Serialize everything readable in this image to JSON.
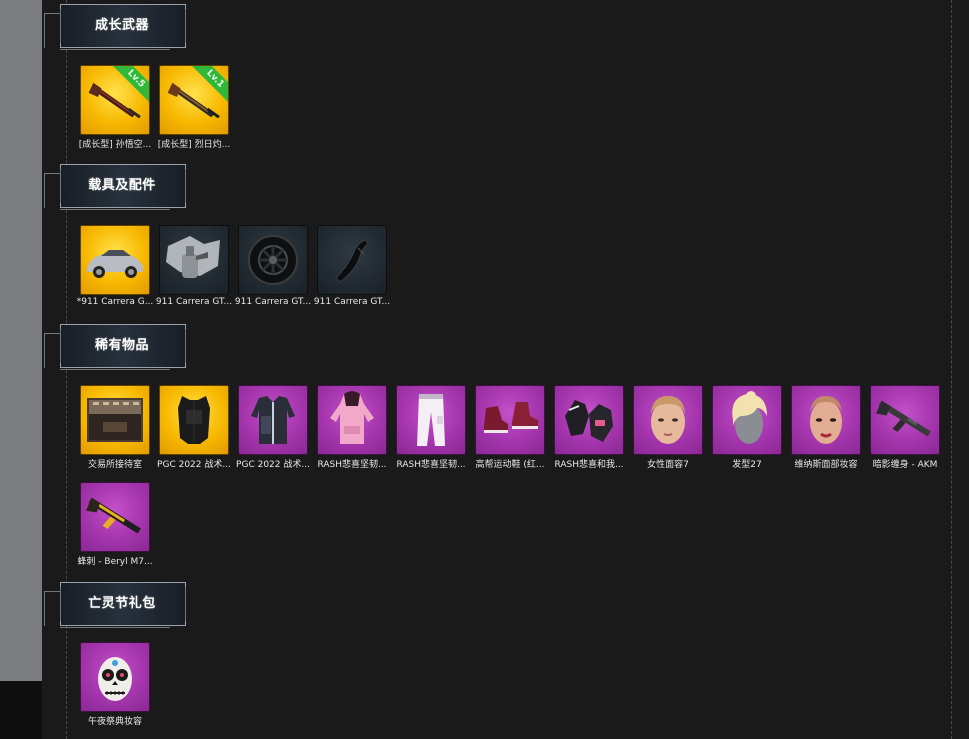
{
  "sections": [
    {
      "title": "成长武器",
      "items": [
        {
          "caption": "[成长型] 孙悟空...",
          "rarity": "gold",
          "icon": "shotgun-icon",
          "badge": "Lv.5"
        },
        {
          "caption": "[成长型] 烈日灼...",
          "rarity": "gold",
          "icon": "shotgun-icon",
          "badge": "Lv.1"
        }
      ]
    },
    {
      "title": "载具及配件",
      "items": [
        {
          "caption": "*911 Carrera G...",
          "rarity": "gold",
          "icon": "sports-car-icon"
        },
        {
          "caption": "911 Carrera GT...",
          "rarity": "dark",
          "icon": "car-paint-icon"
        },
        {
          "caption": "911 Carrera GT...",
          "rarity": "dark",
          "icon": "wheel-icon"
        },
        {
          "caption": "911 Carrera GT...",
          "rarity": "dark",
          "icon": "car-part-icon"
        }
      ]
    },
    {
      "title": "稀有物品",
      "items": [
        {
          "caption": "交易所接待室",
          "rarity": "gold",
          "icon": "room-icon"
        },
        {
          "caption": "PGC 2022 战术...",
          "rarity": "gold",
          "icon": "tactical-vest-icon"
        },
        {
          "caption": "PGC 2022 战术...",
          "rarity": "purple",
          "icon": "jacket-icon"
        },
        {
          "caption": "RASH悲喜坚韧...",
          "rarity": "purple",
          "icon": "hoodie-icon"
        },
        {
          "caption": "RASH悲喜坚韧...",
          "rarity": "purple",
          "icon": "pants-icon"
        },
        {
          "caption": "高帮运动鞋 (红...",
          "rarity": "purple",
          "icon": "sneakers-icon"
        },
        {
          "caption": "RASH悲喜和我...",
          "rarity": "purple",
          "icon": "gloves-icon"
        },
        {
          "caption": "女性面容7",
          "rarity": "purple",
          "icon": "female-face-icon"
        },
        {
          "caption": "发型27",
          "rarity": "purple",
          "icon": "hairstyle-icon"
        },
        {
          "caption": "维纳斯面部妆容",
          "rarity": "purple",
          "icon": "makeup-face-icon"
        },
        {
          "caption": "暗影缠身 - AKM",
          "rarity": "purple",
          "icon": "rifle-icon"
        },
        {
          "caption": "蜂刺 - Beryl M7...",
          "rarity": "purple",
          "icon": "rifle-icon"
        }
      ]
    },
    {
      "title": "亡灵节礼包",
      "items": [
        {
          "caption": "午夜祭典妆容",
          "rarity": "purple",
          "icon": "skull-makeup-icon"
        }
      ]
    }
  ],
  "colors": {
    "gold": "#f7b900",
    "purple": "#a435ad",
    "dark": "#222a31",
    "level_badge": "#2fb83a",
    "background": "#1a1a1a"
  }
}
